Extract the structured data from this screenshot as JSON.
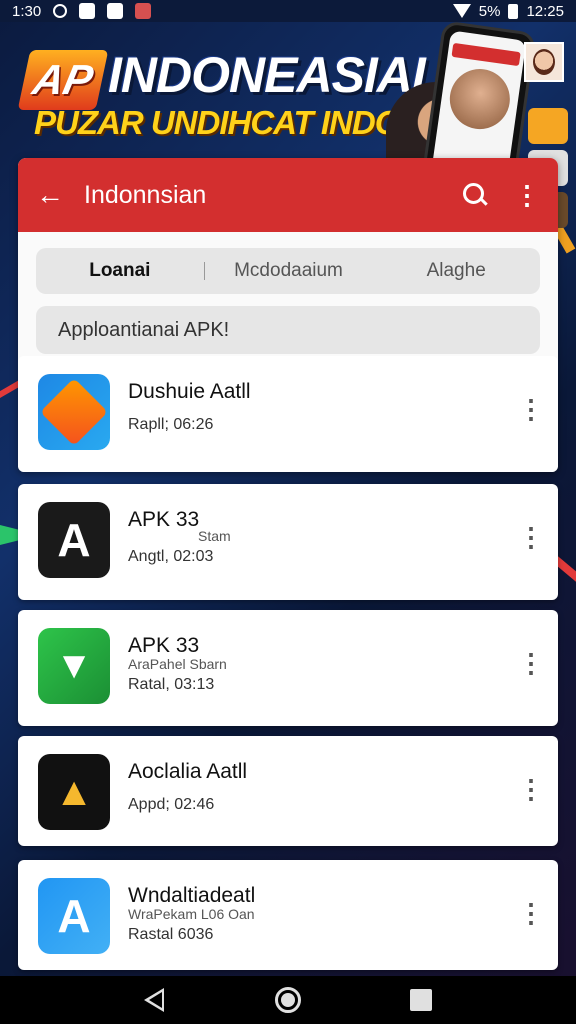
{
  "status_bar": {
    "time_left": "1:30",
    "battery": "5%",
    "time_right": "12:25"
  },
  "banner": {
    "logo_text": "AP",
    "title": "INDONEASIAI",
    "subtitle": "PUZAR UNDIHCAT INDORAIN"
  },
  "app_bar": {
    "title": "Indonnsian"
  },
  "tabs": [
    {
      "label": "Loanai"
    },
    {
      "label": "Mcdodaaium"
    },
    {
      "label": "Alaghe"
    }
  ],
  "search": {
    "text": "Apploantianai APK!"
  },
  "apps": [
    {
      "name": "Dushuie Aatll",
      "sub": "",
      "meta": "Rapll; 06:26"
    },
    {
      "name": "APK 33",
      "sub": "Stam",
      "meta": "Angtl, 02:03"
    },
    {
      "name": "APK 33",
      "sub": "AraPahel Sbarn",
      "meta": "Ratal, 03:13"
    },
    {
      "name": "Aoclalia Aatll",
      "sub": "",
      "meta": "Appd; 02:46"
    },
    {
      "name": "Wndaltiadeatl",
      "sub": "WraPekam L06 Oan",
      "meta": "Rastal 6036"
    }
  ],
  "colors": {
    "app_bar": "#d32f2f",
    "banner_title": "#ffffff",
    "banner_subtitle": "#ffd21a"
  }
}
